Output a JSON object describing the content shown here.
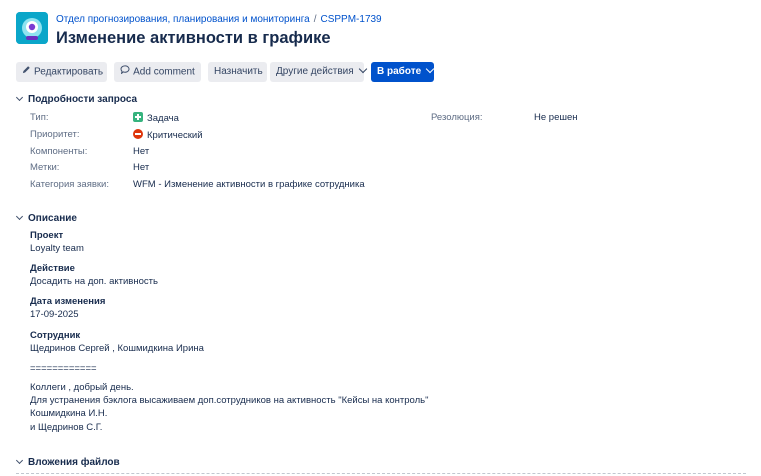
{
  "header": {
    "project_link": "Отдел прогнозирования, планирования и мониторинга",
    "breadcrumb_separator": "/",
    "issue_key": "CSPPM-1739",
    "title": "Изменение активности в графике"
  },
  "toolbar": {
    "edit_label": "Редактировать",
    "comment_label": "Add comment",
    "assign_label": "Назначить",
    "more_label": "Другие действия",
    "status_label": "В работе"
  },
  "details": {
    "section_title": "Подробности запроса",
    "type_label": "Тип:",
    "type_value": "Задача",
    "priority_label": "Приоритет:",
    "priority_value": "Критический",
    "components_label": "Компоненты:",
    "components_value": "Нет",
    "labels_label": "Метки:",
    "labels_value": "Нет",
    "category_label": "Категория заявки:",
    "category_value": "WFM - Изменение активности в графике сотрудника",
    "resolution_label": "Резолюция:",
    "resolution_value": "Не решен"
  },
  "description": {
    "section_title": "Описание",
    "project_heading": "Проект",
    "project_value": "Loyalty team",
    "action_heading": "Действие",
    "action_value": "Досадить на доп. активность",
    "date_heading": "Дата изменения",
    "date_value": "17-09-2025",
    "employee_heading": "Сотрудник",
    "employee_value": "Щедринов Сергей , Кошмидкина Ирина",
    "separator_line": "============",
    "message_lines": [
      "Коллеги , добрый день.",
      "Для устранения бэклога высаживаем доп.сотрудников на активность \"Кейсы на контроль\"",
      "Кошмидкина И.Н.",
      "и Щедринов С.Г."
    ]
  },
  "attachments": {
    "section_title": "Вложения файлов"
  },
  "colors": {
    "primary": "#0052cc",
    "avatar_bg": "#0aa6c9",
    "type_icon": "#36b37e",
    "priority_icon": "#de350b"
  },
  "icons": {
    "avatar": "project-avatar-icon",
    "edit": "pencil-icon",
    "comment": "comment-bubble-icon",
    "type": "task-plus-icon",
    "priority": "critical-priority-icon"
  }
}
